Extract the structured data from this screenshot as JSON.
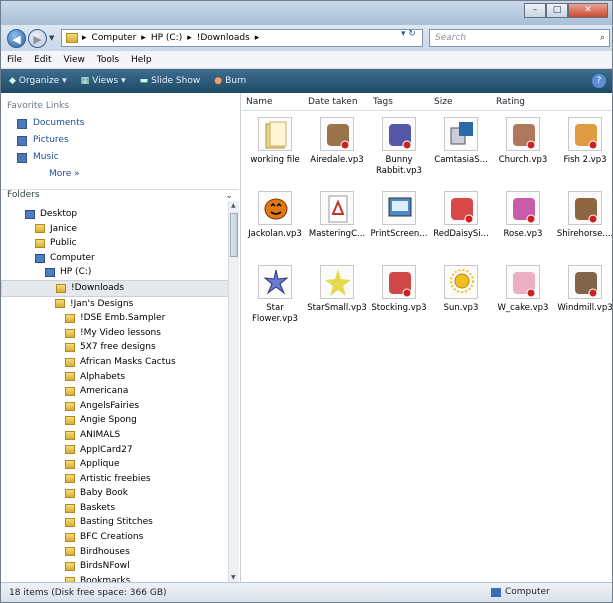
{
  "window": {
    "min": "–",
    "max": "□",
    "close": "✕"
  },
  "address": {
    "crumbs": [
      "Computer",
      "HP (C:)",
      "!Downloads"
    ],
    "sep": "▸",
    "search_placeholder": "Search"
  },
  "menu": [
    "File",
    "Edit",
    "View",
    "Tools",
    "Help"
  ],
  "toolbar": {
    "organize": "Organize",
    "views": "Views",
    "slideshow": "Slide Show",
    "burn": "Burn"
  },
  "nav": {
    "favorites_header": "Favorite Links",
    "favorites": [
      "Documents",
      "Pictures",
      "Music"
    ],
    "more": "More »",
    "folders_header": "Folders",
    "tree": [
      {
        "label": "Desktop",
        "indent": 0,
        "kind": "pc"
      },
      {
        "label": "Janice",
        "indent": 1,
        "kind": "folder"
      },
      {
        "label": "Public",
        "indent": 1,
        "kind": "folder"
      },
      {
        "label": "Computer",
        "indent": 1,
        "kind": "pc"
      },
      {
        "label": "HP (C:)",
        "indent": 2,
        "kind": "pc"
      },
      {
        "label": "!Downloads",
        "indent": 3,
        "kind": "folder",
        "selected": true
      },
      {
        "label": "!Jan's Designs",
        "indent": 3,
        "kind": "folder"
      },
      {
        "label": "!DSE Emb.Sampler",
        "indent": 4,
        "kind": "folder"
      },
      {
        "label": "!My Video lessons",
        "indent": 4,
        "kind": "folder"
      },
      {
        "label": "5X7 free designs",
        "indent": 4,
        "kind": "folder"
      },
      {
        "label": "African Masks Cactus",
        "indent": 4,
        "kind": "folder"
      },
      {
        "label": "Alphabets",
        "indent": 4,
        "kind": "folder"
      },
      {
        "label": "Americana",
        "indent": 4,
        "kind": "folder"
      },
      {
        "label": "AngelsFairies",
        "indent": 4,
        "kind": "folder"
      },
      {
        "label": "Angie Spong",
        "indent": 4,
        "kind": "folder"
      },
      {
        "label": "ANIMALS",
        "indent": 4,
        "kind": "folder"
      },
      {
        "label": "ApplCard27",
        "indent": 4,
        "kind": "folder"
      },
      {
        "label": "Applique",
        "indent": 4,
        "kind": "folder"
      },
      {
        "label": "Artistic freebies",
        "indent": 4,
        "kind": "folder"
      },
      {
        "label": "Baby Book",
        "indent": 4,
        "kind": "folder"
      },
      {
        "label": "Baskets",
        "indent": 4,
        "kind": "folder"
      },
      {
        "label": "Basting Stitches",
        "indent": 4,
        "kind": "folder"
      },
      {
        "label": "BFC Creations",
        "indent": 4,
        "kind": "folder"
      },
      {
        "label": "Birdhouses",
        "indent": 4,
        "kind": "folder"
      },
      {
        "label": "BirdsNFowl",
        "indent": 4,
        "kind": "folder"
      },
      {
        "label": "Bookmarks",
        "indent": 4,
        "kind": "folder"
      }
    ]
  },
  "columns": [
    "Name",
    "Date taken",
    "Tags",
    "Size",
    "Rating"
  ],
  "files": [
    {
      "name": "working file",
      "icon": "folder",
      "color": "#e9d48a"
    },
    {
      "name": "Airedale.vp3",
      "icon": "dog",
      "color": "#8a5a2b"
    },
    {
      "name": "Bunny Rabbit.vp3",
      "icon": "rabbit",
      "color": "#3a3a9a"
    },
    {
      "name": "CamtasiaS...",
      "icon": "software",
      "color": "#2a6aa8"
    },
    {
      "name": "Church.vp3",
      "icon": "church",
      "color": "#a06040"
    },
    {
      "name": "Fish 2.vp3",
      "icon": "fish",
      "color": "#d88a20"
    },
    {
      "name": "Jackolan.vp3",
      "icon": "pumpkin",
      "color": "#e07a10"
    },
    {
      "name": "MasteringC...",
      "icon": "pdf",
      "color": "#c83030"
    },
    {
      "name": "PrintScreen...",
      "icon": "program",
      "color": "#4a8ac8"
    },
    {
      "name": "RedDaisySi...",
      "icon": "daisy",
      "color": "#d02828"
    },
    {
      "name": "Rose.vp3",
      "icon": "rose",
      "color": "#c0409a"
    },
    {
      "name": "Shirehorse....",
      "icon": "horse",
      "color": "#7a4a20"
    },
    {
      "name": "Star Flower.vp3",
      "icon": "starflower",
      "color": "#6a7ad8"
    },
    {
      "name": "StarSmall.vp3",
      "icon": "star",
      "color": "#e8d850"
    },
    {
      "name": "Stocking.vp3",
      "icon": "stocking",
      "color": "#c82828"
    },
    {
      "name": "Sun.vp3",
      "icon": "sun",
      "color": "#f0c020"
    },
    {
      "name": "W_cake.vp3",
      "icon": "cake",
      "color": "#e8a0b8"
    },
    {
      "name": "Windmill.vp3",
      "icon": "windmill",
      "color": "#6a4a2a"
    }
  ],
  "status": {
    "left": "18 items (Disk free space: 366 GB)",
    "right": "Computer"
  }
}
